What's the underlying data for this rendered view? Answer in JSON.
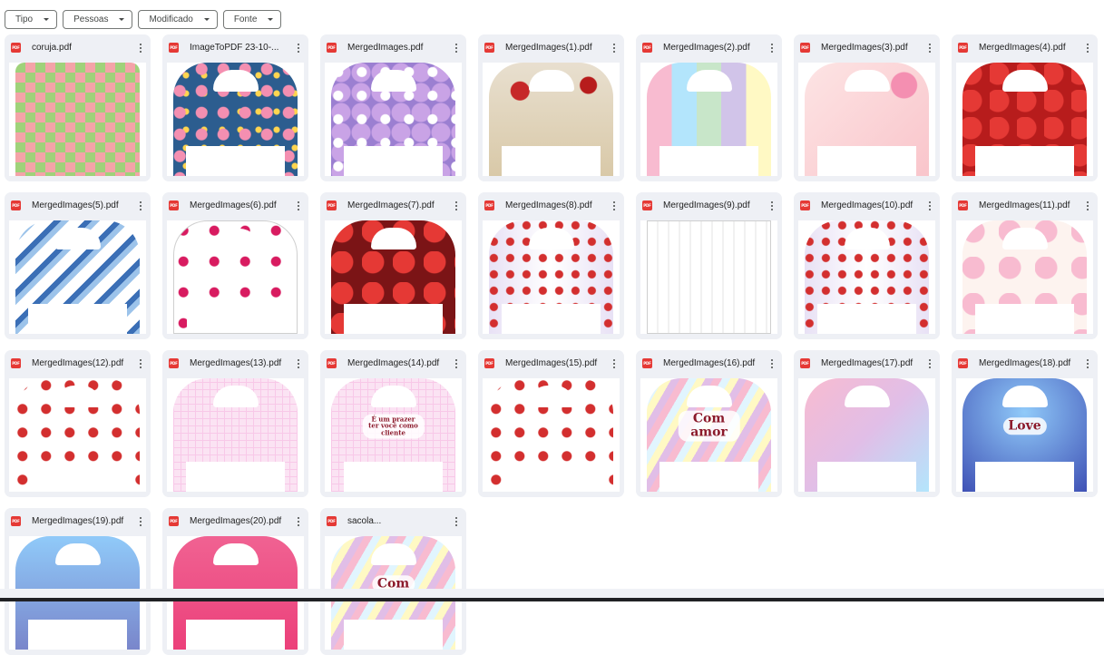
{
  "filters": [
    {
      "label": "Tipo"
    },
    {
      "label": "Pessoas"
    },
    {
      "label": "Modificado"
    },
    {
      "label": "Fonte"
    }
  ],
  "file_icon": "pdf-icon",
  "file_icon_text": "PDF",
  "files": [
    {
      "name": "coruja.pdf"
    },
    {
      "name": "ImageToPDF 23-10-..."
    },
    {
      "name": "MergedImages.pdf"
    },
    {
      "name": "MergedImages(1).pdf"
    },
    {
      "name": "MergedImages(2).pdf"
    },
    {
      "name": "MergedImages(3).pdf"
    },
    {
      "name": "MergedImages(4).pdf"
    },
    {
      "name": "MergedImages(5).pdf"
    },
    {
      "name": "MergedImages(6).pdf"
    },
    {
      "name": "MergedImages(7).pdf"
    },
    {
      "name": "MergedImages(8).pdf"
    },
    {
      "name": "MergedImages(9).pdf"
    },
    {
      "name": "MergedImages(10).pdf"
    },
    {
      "name": "MergedImages(11).pdf"
    },
    {
      "name": "MergedImages(12).pdf"
    },
    {
      "name": "MergedImages(13).pdf"
    },
    {
      "name": "MergedImages(14).pdf"
    },
    {
      "name": "MergedImages(15).pdf"
    },
    {
      "name": "MergedImages(16).pdf"
    },
    {
      "name": "MergedImages(17).pdf"
    },
    {
      "name": "MergedImages(18).pdf"
    },
    {
      "name": "MergedImages(19).pdf"
    },
    {
      "name": "MergedImages(20).pdf"
    },
    {
      "name": "sacola..."
    }
  ],
  "thumb_texts": {
    "mergedimages_14": "É um prazer ter você como cliente",
    "mergedimages_16": "Com amor",
    "mergedimages_18": "Love",
    "sacola": "Com"
  },
  "colors": {
    "card_bg": "#eef0f5",
    "pdf_red": "#e53935"
  }
}
